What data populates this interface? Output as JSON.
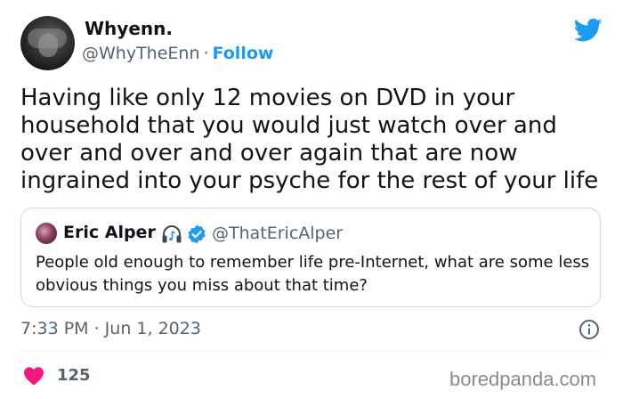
{
  "author": {
    "name": "Whyenn.",
    "handle": "@WhyTheEnn",
    "separator": "·",
    "follow_label": "Follow"
  },
  "tweet": {
    "text": "Having like only 12 movies on DVD in your household that you would just watch over and over and over and over again that are now ingrained into your psyche for the rest of your life"
  },
  "quote": {
    "name": "Eric Alper",
    "handle": "@ThatEricAlper",
    "text": "People old enough to remember life pre-Internet, what are some less obvious things you miss about that time?"
  },
  "meta": {
    "timestamp": "7:33 PM · Jun 1, 2023",
    "likes": "125"
  },
  "watermark": "boredpanda.com",
  "colors": {
    "accent": "#1d9bf0",
    "heart": "#f91880",
    "muted": "#536471",
    "text": "#0f1419",
    "border": "#cfd9de"
  },
  "icons": [
    "twitter-bird-icon",
    "headphones-icon",
    "verified-badge-icon",
    "info-icon",
    "heart-icon"
  ]
}
